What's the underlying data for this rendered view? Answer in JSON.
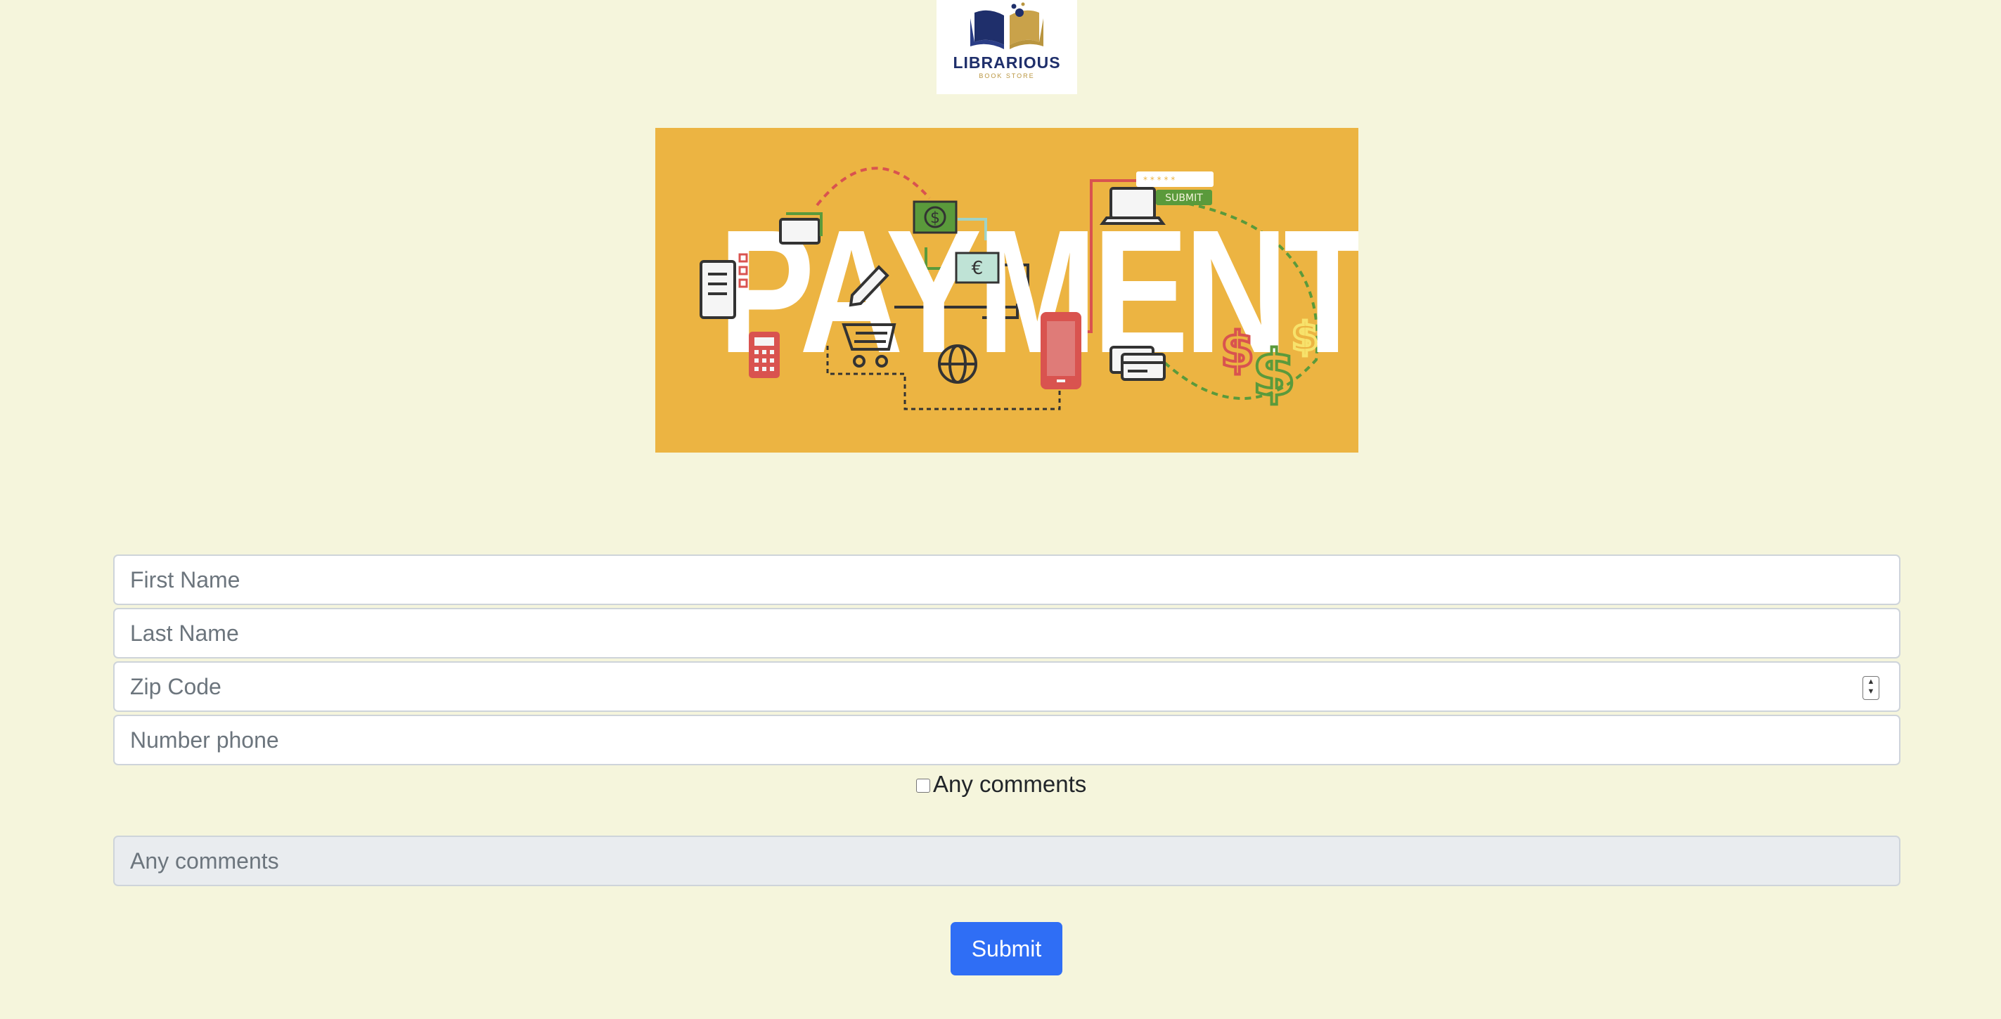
{
  "header": {
    "logo_title": "LIBRARIOUS",
    "logo_subtitle": "BOOK STORE",
    "logo_colors": {
      "navy": "#1f2f6b",
      "gold": "#b9953f"
    }
  },
  "banner": {
    "word": "PAYMENT",
    "button_text": "SUBMIT",
    "background_color": "#ecb442"
  },
  "form": {
    "first_name": {
      "placeholder": "First Name",
      "value": ""
    },
    "last_name": {
      "placeholder": "Last Name",
      "value": ""
    },
    "zip_code": {
      "placeholder": "Zip Code",
      "value": ""
    },
    "phone": {
      "placeholder": "Number phone",
      "value": ""
    },
    "comments_checkbox": {
      "label": "Any comments",
      "checked": false
    },
    "comments": {
      "placeholder": "Any comments",
      "value": ""
    },
    "submit_label": "Submit"
  },
  "colors": {
    "page_background": "#f5f5dc",
    "primary": "#2f6ef5",
    "input_border": "#ced4da",
    "disabled_input": "#e9ecef"
  }
}
